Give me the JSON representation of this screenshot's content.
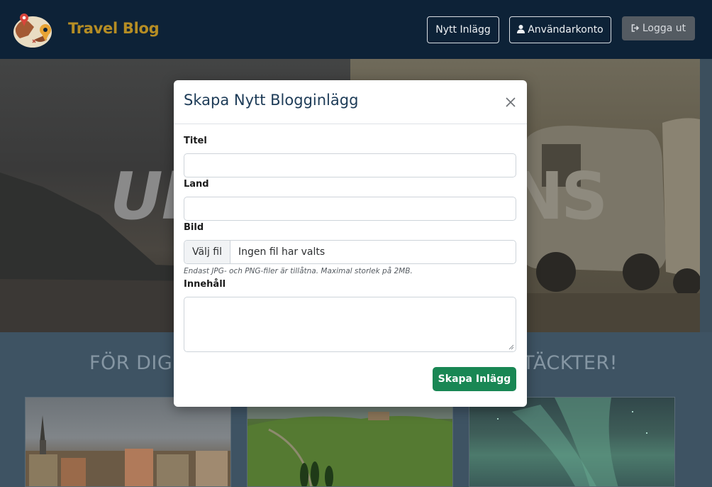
{
  "navbar": {
    "brand": "Travel Blog",
    "new_post_label": "Nytt Inlägg",
    "account_label": "Användarkonto",
    "logout_label": "Logga ut",
    "brand_color": "#b58d24",
    "background_color": "#0d2237"
  },
  "hero": {
    "text_left": "UP",
    "text_right": "NS"
  },
  "section": {
    "tagline_left": "FÖR DIG S",
    "tagline_right": "TÄCKTER!"
  },
  "modal": {
    "title": "Skapa Nytt Blogginlägg",
    "fields": {
      "title_label": "Titel",
      "title_value": "",
      "country_label": "Land",
      "country_value": "",
      "image_label": "Bild",
      "file_button": "Välj fil",
      "file_status": "Ingen fil har valts",
      "file_hint": "Endast JPG- och PNG-filer är tillåtna. Maximal storlek på 2MB.",
      "content_label": "Innehåll",
      "content_value": ""
    },
    "submit_label": "Skapa Inlägg",
    "submit_color": "#198754"
  }
}
